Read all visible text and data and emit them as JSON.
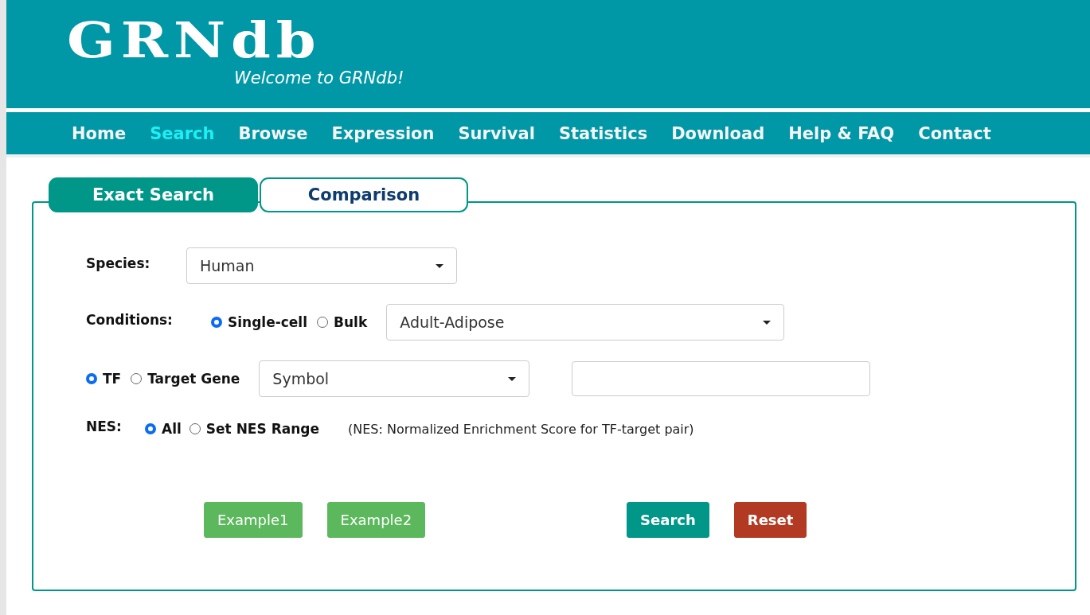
{
  "header": {
    "logo": "GRNdb",
    "tagline": "Welcome to GRNdb!"
  },
  "nav": [
    {
      "label": "Home",
      "selected": false
    },
    {
      "label": "Search",
      "selected": true
    },
    {
      "label": "Browse",
      "selected": false
    },
    {
      "label": "Expression",
      "selected": false
    },
    {
      "label": "Survival",
      "selected": false
    },
    {
      "label": "Statistics",
      "selected": false
    },
    {
      "label": "Download",
      "selected": false
    },
    {
      "label": "Help & FAQ",
      "selected": false
    },
    {
      "label": "Contact",
      "selected": false
    }
  ],
  "tabs": [
    {
      "label": "Exact Search",
      "selected": true
    },
    {
      "label": "Comparison",
      "selected": false
    }
  ],
  "form": {
    "species": {
      "label": "Species:",
      "value": "Human"
    },
    "conditions": {
      "label": "Conditions:",
      "options": [
        {
          "label": "Single-cell",
          "selected": true
        },
        {
          "label": "Bulk",
          "selected": false
        }
      ],
      "value": "Adult-Adipose"
    },
    "query": {
      "options": [
        {
          "label": "TF",
          "selected": true
        },
        {
          "label": "Target Gene",
          "selected": false
        }
      ],
      "value": "Symbol"
    },
    "nes": {
      "label": "NES:",
      "options": [
        {
          "label": "All",
          "selected": true
        },
        {
          "label": "Set NES Range",
          "selected": false
        }
      ],
      "note": "(NES: Normalized Enrichment Score for TF-target pair)"
    }
  },
  "buttons": [
    {
      "label": "Example1",
      "kind": "example"
    },
    {
      "label": "Example2",
      "kind": "example"
    },
    {
      "label": "Search",
      "kind": "search"
    },
    {
      "label": "Reset",
      "kind": "reset"
    }
  ]
}
